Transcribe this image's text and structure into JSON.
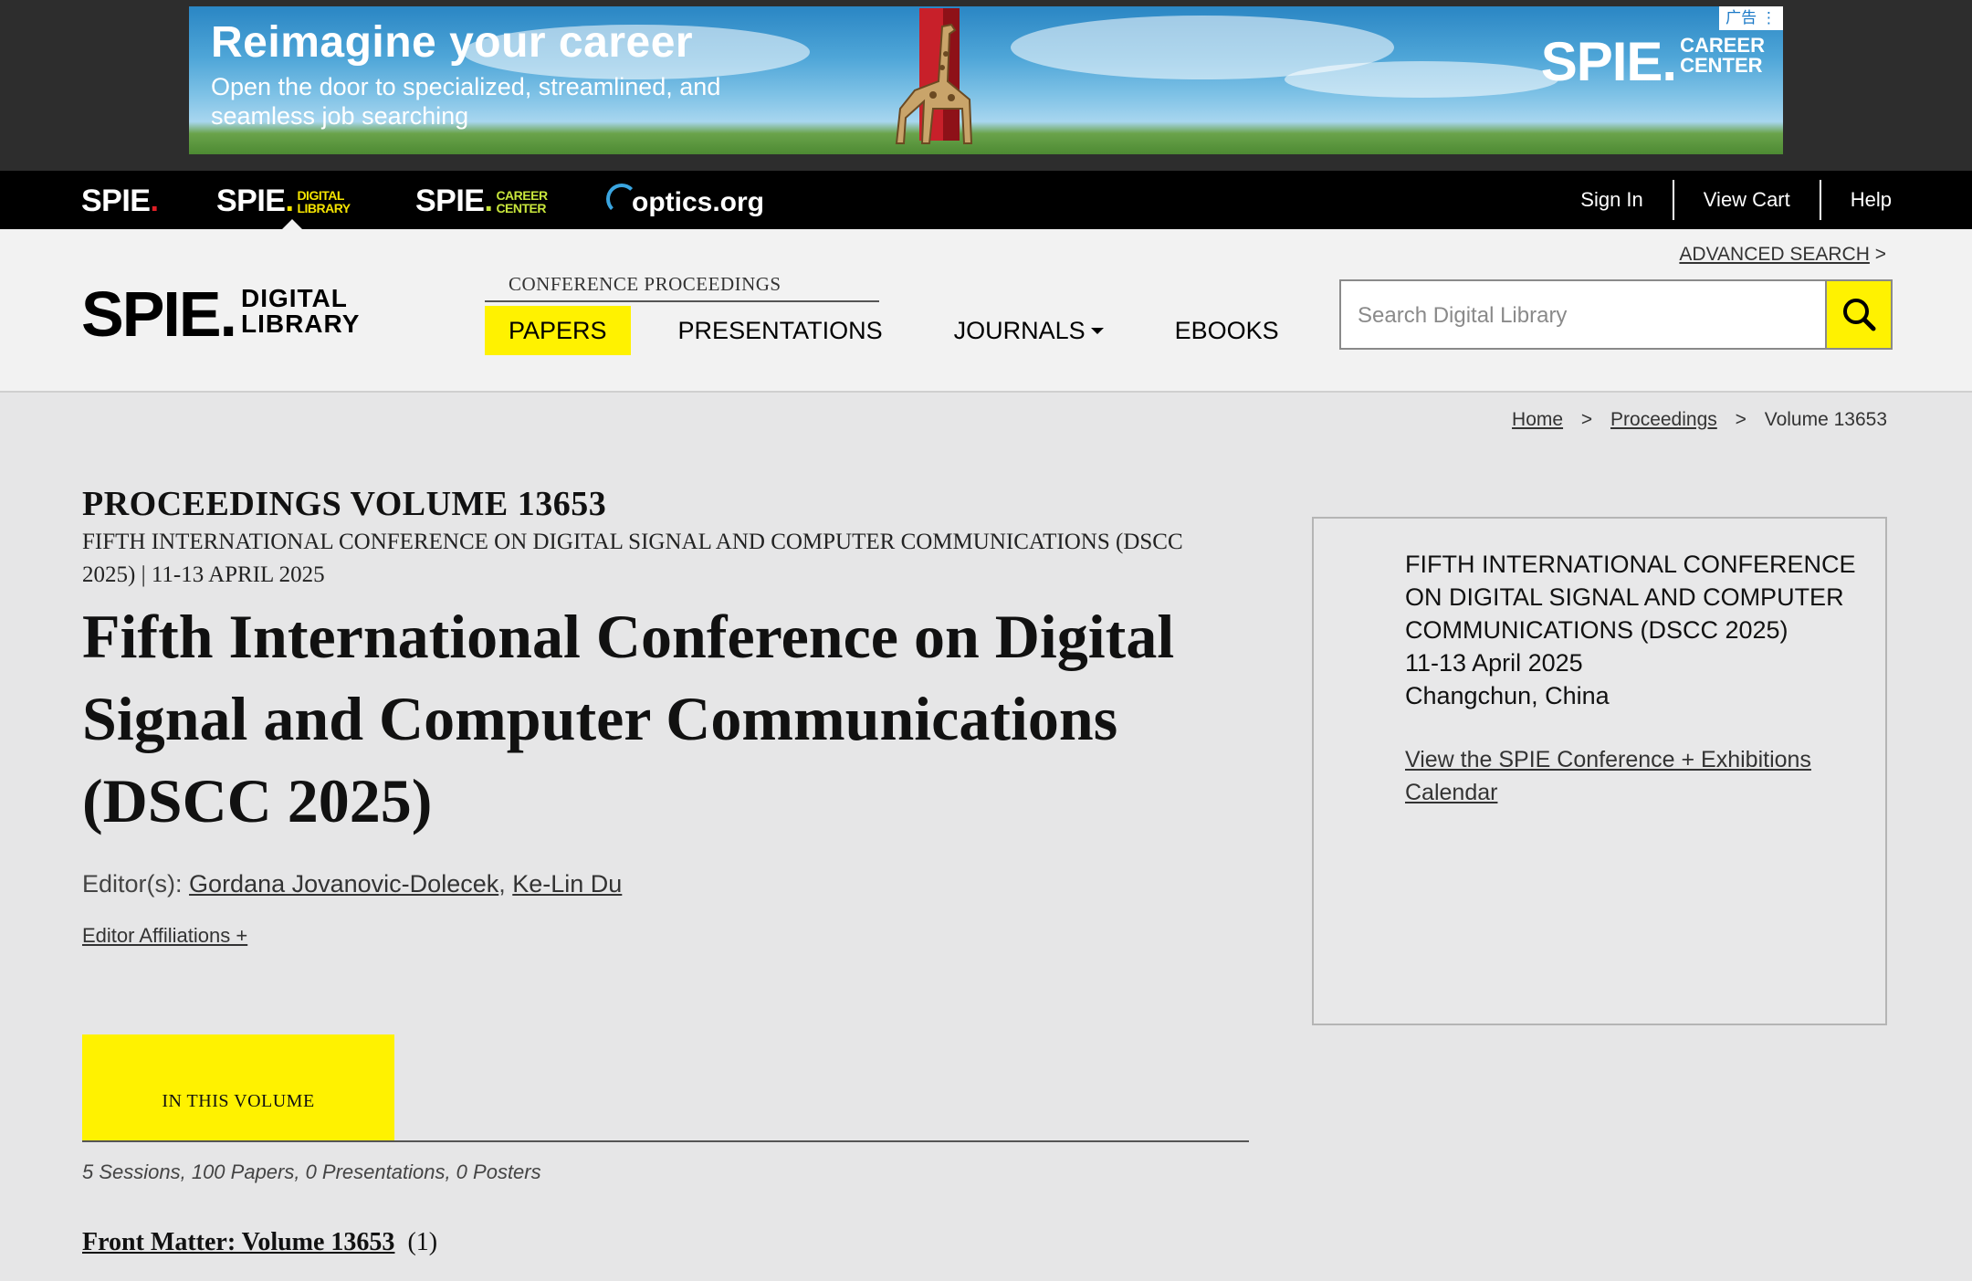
{
  "ad": {
    "headline": "Reimagine your career",
    "subline": "Open the door to specialized, streamlined, and seamless job searching",
    "logo": "SPIE.",
    "logo_tag_1": "CAREER",
    "logo_tag_2": "CENTER",
    "badge": "广告"
  },
  "topbar": {
    "brand_spie": "SPIE",
    "brand_dl": "SPIE",
    "brand_dl_tag_1": "DIGITAL",
    "brand_dl_tag_2": "LIBRARY",
    "brand_cc": "SPIE",
    "brand_cc_tag_1": "CAREER",
    "brand_cc_tag_2": "CENTER",
    "optics": "optics.org",
    "links": [
      "Sign In",
      "View Cart",
      "Help"
    ]
  },
  "header": {
    "logo_main": "SPIE.",
    "logo_tag_1": "DIGITAL",
    "logo_tag_2": "LIBRARY",
    "conf_label": "CONFERENCE PROCEEDINGS",
    "nav": [
      "PAPERS",
      "PRESENTATIONS",
      "JOURNALS",
      "EBOOKS"
    ],
    "advanced_search": "ADVANCED SEARCH",
    "advanced_arrow": ">",
    "search_placeholder": "Search Digital Library"
  },
  "breadcrumb": {
    "home": "Home",
    "proceedings": "Proceedings",
    "current": "Volume 13653",
    "sep": ">"
  },
  "main": {
    "volume_label": "PROCEEDINGS VOLUME 13653",
    "conf_line": "FIFTH INTERNATIONAL CONFERENCE ON DIGITAL SIGNAL AND COMPUTER COMMUNICATIONS (DSCC 2025) | 11-13 APRIL 2025",
    "title": "Fifth International Conference on Digital Signal and Computer Communications (DSCC 2025)",
    "editors_label": "Editor(s):",
    "editor_1": "Gordana Jovanovic-Dolecek",
    "editor_2": "Ke-Lin Du",
    "affiliations": "Editor Affiliations +",
    "tab": "IN THIS VOLUME",
    "counts": "5 Sessions, 100 Papers, 0 Presentations, 0 Posters",
    "front_matter": "Front Matter: Volume 13653",
    "front_count": "(1)"
  },
  "sidebox": {
    "line1": "FIFTH INTERNATIONAL CONFERENCE ON DIGITAL SIGNAL AND COMPUTER COMMUNICATIONS (DSCC 2025)",
    "dates": "11-13 April 2025",
    "location": "Changchun, China",
    "calendar_link": "View the SPIE Conference + Exhibitions Calendar"
  },
  "colors": {
    "accent_yellow": "#fff200",
    "topbar": "#000000",
    "spie_red": "#e01f26"
  }
}
